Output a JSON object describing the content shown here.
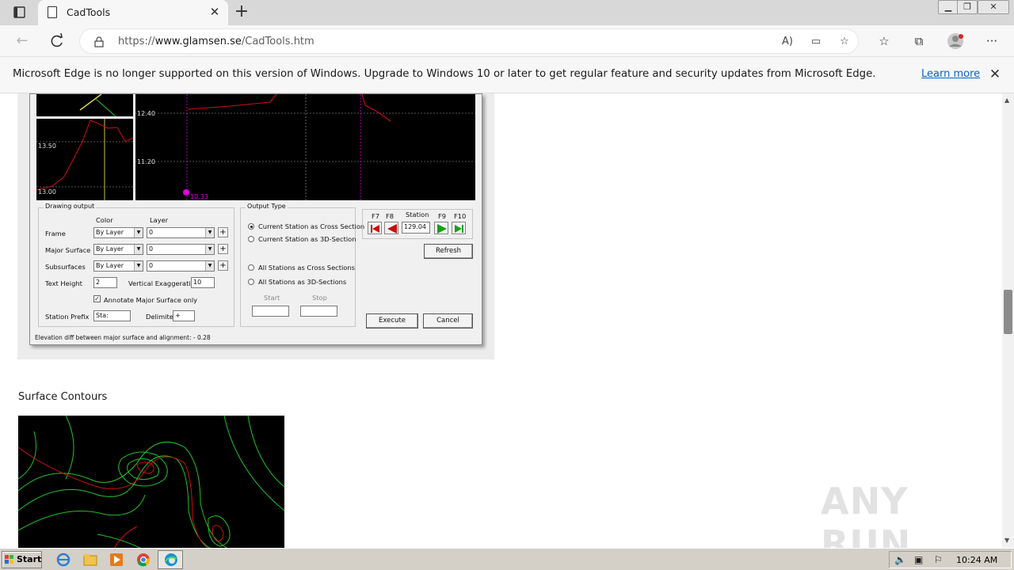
{
  "browser": {
    "tab_title": "CadTools",
    "url_prefix": "https://",
    "url_host": "www.glamsen.se",
    "url_path": "/CadTools.htm"
  },
  "infobar": {
    "message": "Microsoft Edge is no longer supported on this version of Windows. Upgrade to Windows 10 or later to get regular feature and security updates from Microsoft Edge.",
    "learn_more": "Learn more"
  },
  "dialog": {
    "profile_labels": [
      "13.50",
      "13.00"
    ],
    "section_labels": [
      "12.40",
      "11.20",
      "10.33"
    ],
    "drawing_output": {
      "legend": "Drawing output",
      "color_header": "Color",
      "layer_header": "Layer",
      "rows": [
        {
          "label": "Frame",
          "color": "By Layer",
          "layer": "0"
        },
        {
          "label": "Major Surface",
          "color": "By Layer",
          "layer": "0"
        },
        {
          "label": "Subsurfaces",
          "color": "By Layer",
          "layer": "0"
        }
      ],
      "text_height_label": "Text Height",
      "text_height_value": "2",
      "vert_exag_label": "Vertical Exaggeration",
      "vert_exag_value": "10",
      "annotate_label": "Annotate Major Surface only",
      "annotate_checked": true,
      "station_prefix_label": "Station Prefix",
      "station_prefix_value": "Sta:",
      "delimiter_label": "Delimiter",
      "delimiter_value": "+"
    },
    "output_type": {
      "legend": "Output Type",
      "options": [
        "Current Station as Cross Section",
        "Current Station as 3D-Section",
        "All Stations as Cross Sections",
        "All Stations as 3D-Sections"
      ],
      "selected_index": 0,
      "start_label": "Start",
      "stop_label": "Stop"
    },
    "station_nav": {
      "f7": "F7",
      "f8": "F8",
      "station_label": "Station",
      "f9": "F9",
      "f10": "F10",
      "station_value": "129.04"
    },
    "refresh_label": "Refresh",
    "execute_label": "Execute",
    "cancel_label": "Cancel",
    "status_text": "Elevation diff between major surface and alignment: - 0.28"
  },
  "page": {
    "section_title": "Surface Contours",
    "watermark": "ANY RUN"
  },
  "taskbar": {
    "start_label": "Start",
    "clock": "10:24 AM"
  },
  "colors": {
    "link": "#0b62c4",
    "profile_line": "#cc1010",
    "contour_green": "#22c02a",
    "station_marker": "#e000e0"
  }
}
